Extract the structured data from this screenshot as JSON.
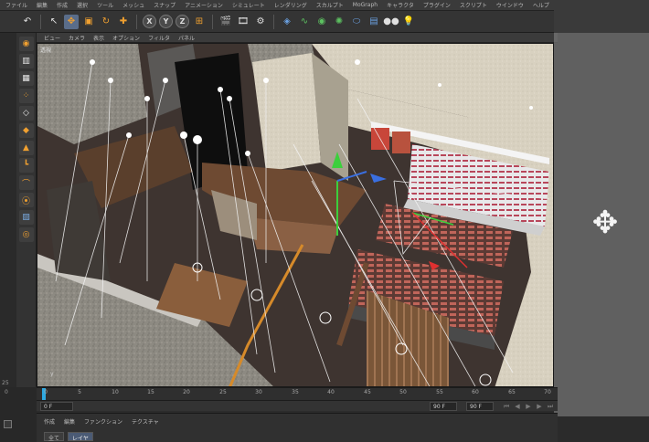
{
  "menu": [
    "ファイル",
    "編集",
    "作成",
    "選択",
    "ツール",
    "メッシュ",
    "スナップ",
    "アニメーション",
    "シミュレート",
    "レンダリング",
    "スカルプト",
    "MoGraph",
    "キャラクタ",
    "プラグイン",
    "スクリプト",
    "ウインドウ",
    "ヘルプ"
  ],
  "toolbar": {
    "undo_icon": "undo-icon",
    "tools": [
      "pointer-icon",
      "move-icon",
      "scale-icon",
      "rotate-icon",
      "add-object-icon"
    ],
    "axis_x": "X",
    "axis_y": "Y",
    "axis_z": "Z",
    "coord_icon": "coordinate-system-icon",
    "render_tools": [
      "render-view-icon",
      "render-picture-viewer-icon",
      "render-settings-icon"
    ],
    "object_tools": [
      "cube-icon",
      "spline-icon",
      "nurbs-icon",
      "array-icon",
      "deformer-icon",
      "scene-icon",
      "camera-icon",
      "light-icon"
    ]
  },
  "viewport": {
    "menu": [
      "ビュー",
      "カメラ",
      "表示",
      "オプション",
      "フィルタ",
      "パネル"
    ],
    "label": "透視",
    "axis_label": "y"
  },
  "left_palette": [
    "model-mode-icon",
    "object-mode-icon",
    "texture-mode-icon",
    "points-mode-icon",
    "edges-mode-icon",
    "polygons-mode-icon",
    "uv-mode-icon",
    "axis-mode-icon",
    "tweak-icon",
    "snap-icon",
    "workplane-icon",
    "lock-icon"
  ],
  "edge_number": "25",
  "timeline": {
    "ticks": [
      "0",
      "5",
      "10",
      "15",
      "20",
      "25",
      "30",
      "35",
      "40",
      "45",
      "50",
      "55",
      "60",
      "65",
      "70"
    ],
    "current_frame": "0 F",
    "start_frame": "0 F",
    "end_frame": "90 F",
    "fps_field": "90 F"
  },
  "bottom_panel": {
    "menu": [
      "作成",
      "編集",
      "ファンクション",
      "テクスチャ"
    ],
    "tab_1": "全て",
    "tab_2": "レイヤ"
  },
  "bottom_left_number": "0"
}
